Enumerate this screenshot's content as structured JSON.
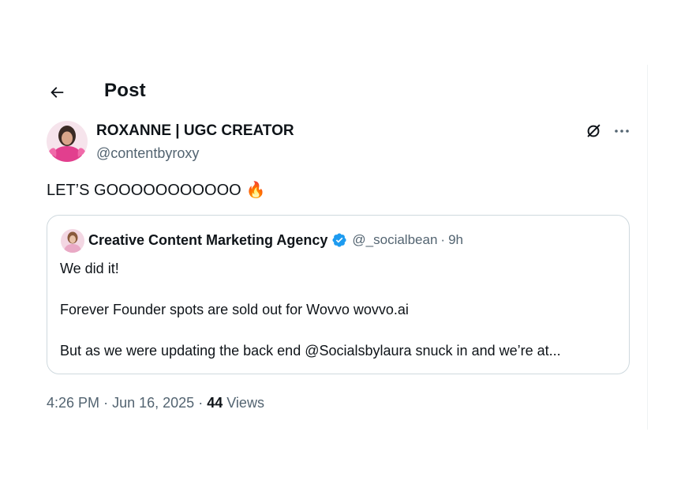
{
  "header": {
    "title": "Post"
  },
  "post": {
    "author": {
      "display_name": "ROXANNE | UGC CREATOR",
      "handle": "@contentbyroxy"
    },
    "text": "LET’S GOOOOOOOOOOO",
    "emoji": "🔥",
    "quote": {
      "author": {
        "display_name": "Creative Content Marketing Agency",
        "handle": "@_socialbean",
        "verified": true
      },
      "separator": "·",
      "time": "9h",
      "lines": [
        "We did it!",
        "Forever Founder spots are sold out for Wovvo wovvo.ai",
        "But as we were updating the back end @Socialsbylaura snuck in and we’re at..."
      ]
    },
    "meta": {
      "time": "4:26 PM",
      "sep1": "·",
      "date": "Jun 16, 2025",
      "sep2": "·",
      "views_count": "44",
      "views_label": "Views"
    }
  },
  "icons": {
    "back": "arrow-left-icon",
    "grok": "grok-icon",
    "more": "more-horizontal-icon",
    "verified": "verified-badge-icon"
  },
  "colors": {
    "verified_blue": "#1d9bf0",
    "text_secondary": "#536471",
    "border": "#cfd9de"
  }
}
